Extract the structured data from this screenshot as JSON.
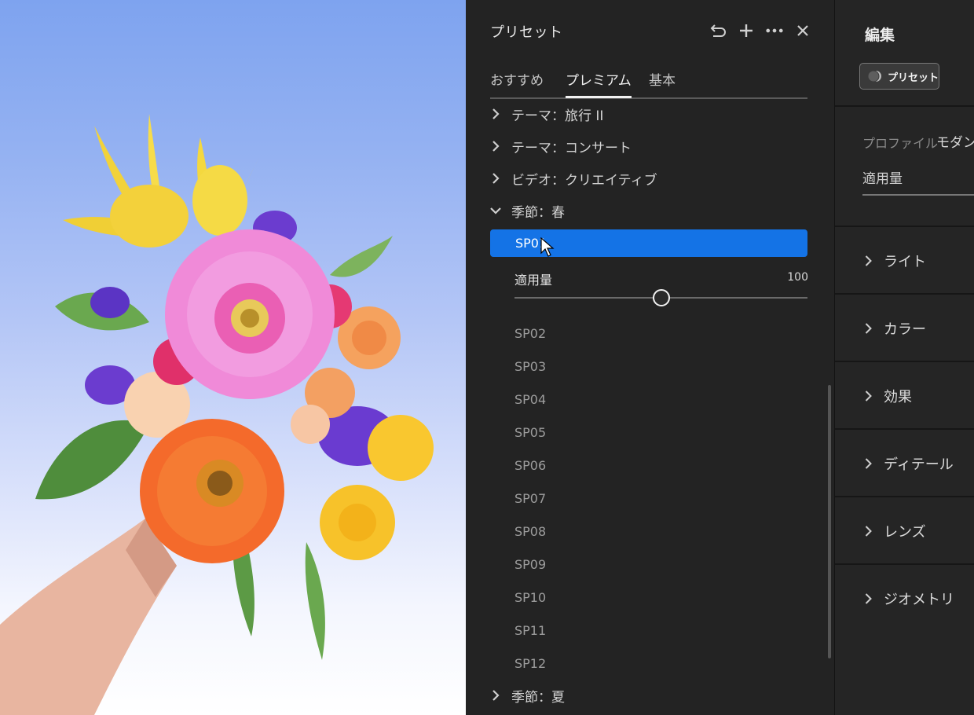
{
  "preset_panel": {
    "title": "プリセット",
    "header_icons": [
      "undo-icon",
      "plus-icon",
      "more-icon",
      "close-icon"
    ],
    "tabs": [
      {
        "label": "おすすめ",
        "active": false
      },
      {
        "label": "プレミアム",
        "active": true
      },
      {
        "label": "基本",
        "active": false
      }
    ],
    "groups": [
      {
        "label": "テーマ：旅行 II",
        "expanded": false
      },
      {
        "label": "テーマ：コンサート",
        "expanded": false
      },
      {
        "label": "ビデオ：クリエイティブ",
        "expanded": false
      },
      {
        "label": "季節：春",
        "expanded": true
      },
      {
        "label": "季節：夏",
        "expanded": false
      }
    ],
    "selected_preset": "SP01",
    "amount": {
      "label": "適用量",
      "value": "100",
      "fraction": 0.5
    },
    "presets": [
      "SP02",
      "SP03",
      "SP04",
      "SP05",
      "SP06",
      "SP07",
      "SP08",
      "SP09",
      "SP10",
      "SP11",
      "SP12"
    ],
    "accent_color": "#1473e6"
  },
  "edit_panel": {
    "title": "編集",
    "preset_button": "プリセット",
    "profile_label": "プロファイル",
    "profile_value": "モダン",
    "amount_label": "適用量",
    "sections": [
      "ライト",
      "カラー",
      "効果",
      "ディテール",
      "レンズ",
      "ジオメトリ"
    ]
  }
}
